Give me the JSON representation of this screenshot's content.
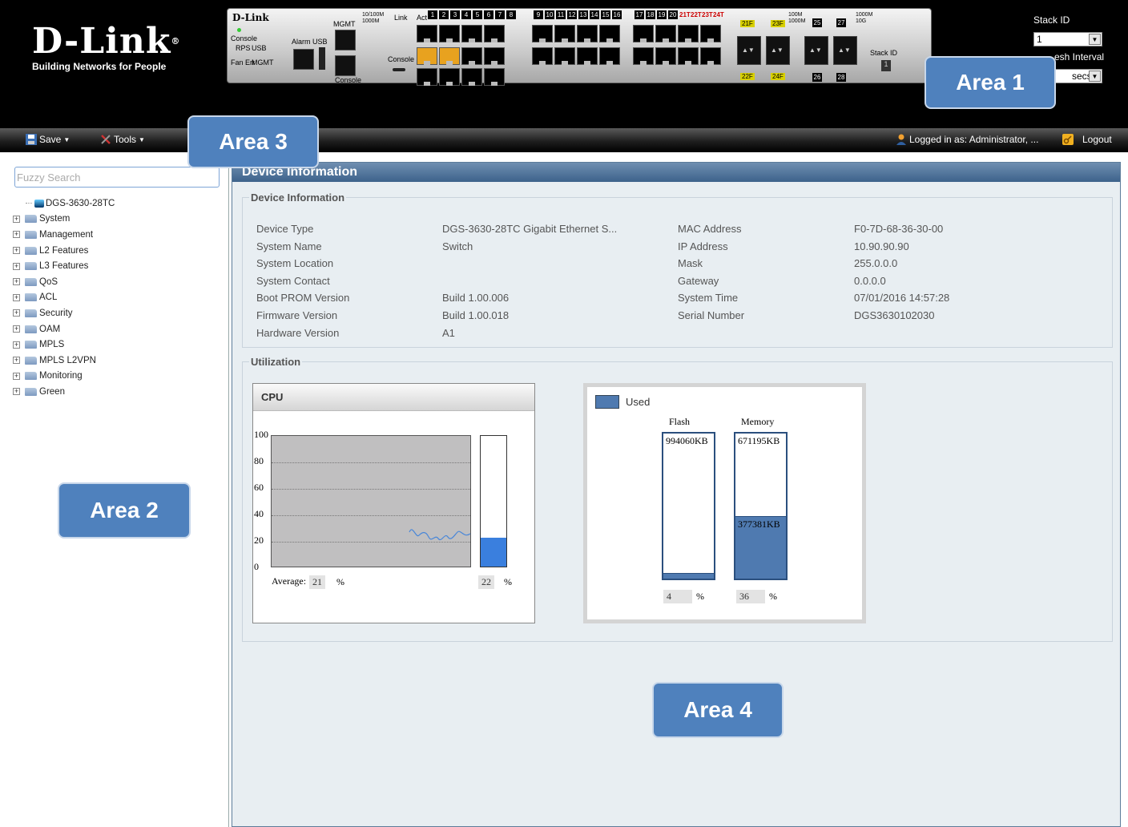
{
  "header": {
    "logo_text": "D-Link",
    "logo_tagline": "Building Networks for People",
    "panel": {
      "brand": "D-Link",
      "model": "DGS-3630-28TC",
      "labels": {
        "console_top": "Console",
        "rps": "RPS",
        "fan_err": "Fan Err",
        "usb": "USB",
        "mgmt": "MGMT",
        "alarm_usb": "Alarm USB",
        "mgmt_top": "MGMT",
        "speed_top": "10/100M 1000M",
        "link": "Link",
        "act": "Act",
        "console_mid": "Console",
        "console_bottom": "Console",
        "stack_id": "Stack ID",
        "speed_right": "100M 1000M",
        "speed_far": "1000M 10G"
      },
      "port_numbers_a": [
        "1",
        "2",
        "3",
        "4",
        "5",
        "6",
        "7",
        "8"
      ],
      "port_numbers_b": [
        "9",
        "10",
        "11",
        "12",
        "13",
        "14",
        "15",
        "16"
      ],
      "port_numbers_c": [
        "17",
        "18",
        "19",
        "20",
        "21T",
        "22T",
        "23T",
        "24T"
      ],
      "sfp_labels": {
        "p21f": "21F",
        "p23f": "23F",
        "p22f": "22F",
        "p24f": "24F",
        "p25": "25",
        "p26": "26",
        "p27": "27",
        "p28": "28"
      },
      "stack_display": "1"
    },
    "stack_id_label": "Stack ID",
    "stack_id_value": "1",
    "refresh_interval_label": "esh Interval",
    "refresh_interval_value": "secs"
  },
  "callouts": {
    "area1": "Area 1",
    "area2": "Area 2",
    "area3": "Area 3",
    "area4": "Area 4"
  },
  "toolbar": {
    "save_label": "Save",
    "tools_label": "Tools",
    "logged_in_text": "Logged in as: Administrator, ...",
    "logout_label": "Logout"
  },
  "sidebar": {
    "search_placeholder": "Fuzzy Search",
    "root": "DGS-3630-28TC",
    "items": [
      "System",
      "Management",
      "L2 Features",
      "L3 Features",
      "QoS",
      "ACL",
      "Security",
      "OAM",
      "MPLS",
      "MPLS L2VPN",
      "Monitoring",
      "Green"
    ]
  },
  "content": {
    "title": "Device Information",
    "device_info_legend": "Device Information",
    "left_fields": [
      {
        "label": "Device Type",
        "value": "DGS-3630-28TC Gigabit Ethernet S..."
      },
      {
        "label": "System Name",
        "value": "Switch"
      },
      {
        "label": "System Location",
        "value": ""
      },
      {
        "label": "System Contact",
        "value": ""
      },
      {
        "label": "Boot PROM Version",
        "value": "Build 1.00.006"
      },
      {
        "label": "Firmware Version",
        "value": "Build 1.00.018"
      },
      {
        "label": "Hardware Version",
        "value": "A1"
      }
    ],
    "right_fields": [
      {
        "label": "MAC Address",
        "value": "F0-7D-68-36-30-00"
      },
      {
        "label": "IP Address",
        "value": "10.90.90.90"
      },
      {
        "label": "Mask",
        "value": "255.0.0.0"
      },
      {
        "label": "Gateway",
        "value": "0.0.0.0"
      },
      {
        "label": "System Time",
        "value": "07/01/2016 14:57:28"
      },
      {
        "label": "Serial Number",
        "value": "DGS3630102030"
      }
    ],
    "utilization_legend": "Utilization"
  },
  "cpu": {
    "title": "CPU",
    "y_ticks": [
      "100",
      "80",
      "60",
      "40",
      "20",
      "0"
    ],
    "average_label": "Average:",
    "average_value": "21",
    "current_value": "22",
    "current_fraction": 0.22,
    "pct_sign": "%",
    "fill_color": "#3a7fde",
    "line_color": "#4a87d8"
  },
  "memory": {
    "legend_label": "Used",
    "used_color": "#4f7ab0",
    "flash": {
      "name": "Flash",
      "total": "994060KB",
      "used": "",
      "percent": "4",
      "used_fraction": 0.04
    },
    "memory": {
      "name": "Memory",
      "total": "671195KB",
      "used": "377381KB",
      "percent": "36",
      "used_fraction": 0.43
    },
    "pct_sign": "%"
  }
}
